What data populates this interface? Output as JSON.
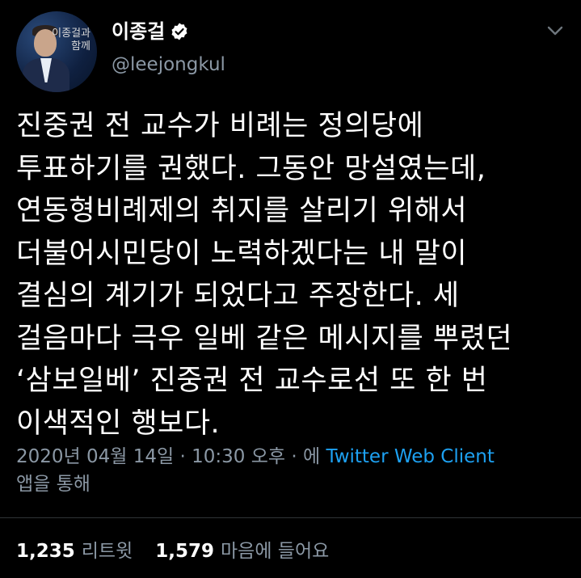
{
  "author": {
    "display_name": "이종걸",
    "handle": "@leejongkul",
    "avatar_text_line1": "이종걸과",
    "avatar_text_line2": "함께",
    "verified": true
  },
  "tweet": {
    "text": "진중권 전 교수가 비례는 정의당에\n투표하기를 권했다. 그동안 망설였는데,\n연동형비례제의 취지를 살리기 위해서\n더불어시민당이 노력하겠다는 내 말이\n결심의 계기가 되었다고 주장한다. 세\n걸음마다 극우 일베 같은 메시지를 뿌렸던\n‘삼보일베’ 진중권 전 교수로선 또 한 번\n이색적인 행보다."
  },
  "meta": {
    "date": "2020년 04월 14일",
    "separator1": " · ",
    "time": "10:30 오후",
    "separator2": " · ",
    "via_prefix": "에 ",
    "source": "Twitter Web Client",
    "via_suffix": "앱을 통해"
  },
  "stats": {
    "retweets_count": "1,235",
    "retweets_label": "리트윗",
    "likes_count": "1,579",
    "likes_label": "마음에 들어요"
  },
  "colors": {
    "background": "#000000",
    "text_primary": "#ffffff",
    "text_secondary": "#8b98a5",
    "link": "#1da1f2"
  },
  "icons": {
    "verified": "verified-badge-icon",
    "menu": "chevron-down-icon"
  }
}
